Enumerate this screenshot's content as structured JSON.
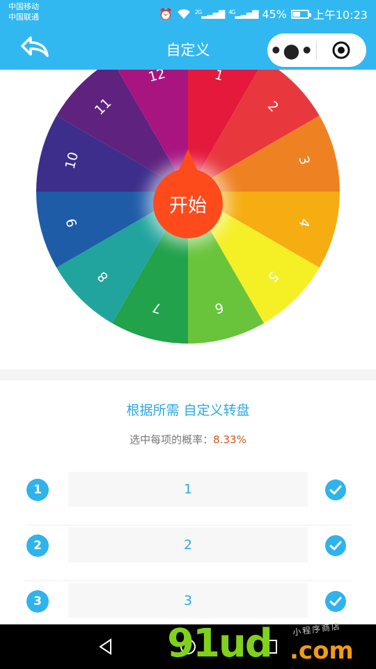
{
  "status_bar": {
    "carrier_1": "中国移动",
    "carrier_2": "中国联通",
    "network_1": "2G",
    "network_2": "4G",
    "battery": "45%",
    "time": "上午10:23"
  },
  "nav": {
    "title": "自定义",
    "icons": [
      "back-arrow-icon",
      "more-icon",
      "target-icon"
    ]
  },
  "wheel": {
    "segments": [
      {
        "label": "1",
        "color": "#e5193c"
      },
      {
        "label": "2",
        "color": "#e8383e"
      },
      {
        "label": "3",
        "color": "#ee8222"
      },
      {
        "label": "4",
        "color": "#f5ad12"
      },
      {
        "label": "5",
        "color": "#f5ef26"
      },
      {
        "label": "6",
        "color": "#69c43c"
      },
      {
        "label": "7",
        "color": "#21a24b"
      },
      {
        "label": "8",
        "color": "#21a49e"
      },
      {
        "label": "9",
        "color": "#1f5ca8"
      },
      {
        "label": "10",
        "color": "#3d2e8c"
      },
      {
        "label": "11",
        "color": "#5f227f"
      },
      {
        "label": "12",
        "color": "#a81581"
      }
    ],
    "start_label": "开始",
    "start_color": "#ff4a1c"
  },
  "info": {
    "title": "根据所需 自定义转盘",
    "prob_label": "选中每项的概率：",
    "prob_value": "8.33%",
    "items": [
      {
        "index": "1",
        "value": "1"
      },
      {
        "index": "2",
        "value": "2"
      },
      {
        "index": "3",
        "value": "3"
      }
    ]
  },
  "colors": {
    "accent": "#32b8f0",
    "text_accent": "#2ea9dd",
    "prob_highlight": "#c8561e"
  },
  "watermark": {
    "main": "91ud",
    "suffix": ".com",
    "small": "小程序商店"
  }
}
